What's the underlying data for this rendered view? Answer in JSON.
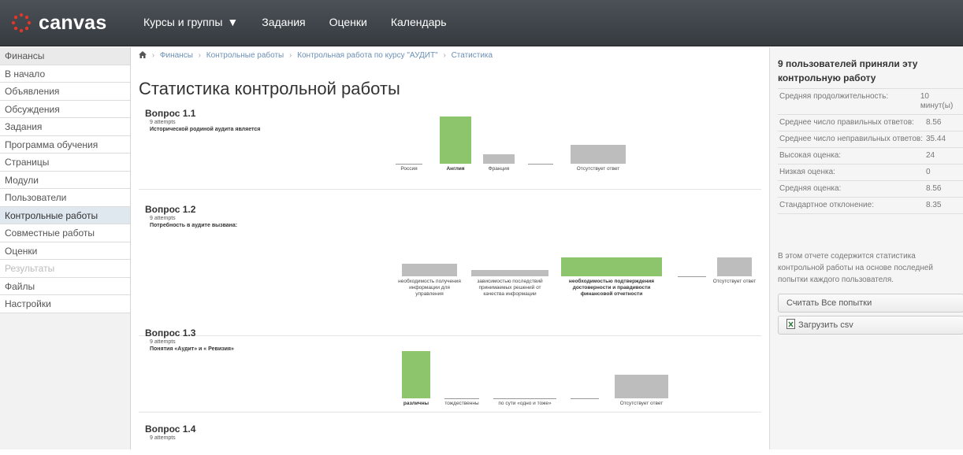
{
  "header": {
    "logo_text": "canvas",
    "nav": [
      "Курсы и группы",
      "Задания",
      "Оценки",
      "Календарь"
    ]
  },
  "sidebar": {
    "items": [
      {
        "label": "Финансы",
        "state": "course"
      },
      {
        "label": "В начало"
      },
      {
        "label": "Объявления"
      },
      {
        "label": "Обсуждения"
      },
      {
        "label": "Задания"
      },
      {
        "label": "Программа обучения"
      },
      {
        "label": "Страницы"
      },
      {
        "label": "Модули"
      },
      {
        "label": "Пользователи"
      },
      {
        "label": "Контрольные работы",
        "state": "active"
      },
      {
        "label": "Совместные работы"
      },
      {
        "label": "Оценки"
      },
      {
        "label": "Результаты",
        "state": "disabled"
      },
      {
        "label": "Файлы"
      },
      {
        "label": "Настройки"
      }
    ]
  },
  "breadcrumb": [
    "Финансы",
    "Контрольные работы",
    "Контрольная работа по курсу \"АУДИТ\"",
    "Статистика"
  ],
  "page_title": "Статистика контрольной работы",
  "questions": [
    {
      "title": "Вопрос 1.1",
      "attempts": "9 attempts",
      "text": "Исторической родиной аудита является",
      "answers": [
        {
          "label": "Россия",
          "value": 0,
          "correct": false
        },
        {
          "label": "Англия",
          "value": 5,
          "correct": true
        },
        {
          "label": "Франция",
          "value": 1,
          "correct": false
        },
        {
          "label": "",
          "value": 0,
          "correct": false
        },
        {
          "label": "Отсутствует ответ",
          "value": 2,
          "correct": false
        }
      ]
    },
    {
      "title": "Вопрос 1.2",
      "attempts": "9 attempts",
      "text": "Потребность в аудите вызвана:",
      "answers": [
        {
          "label": "необходимость получения информации для управления",
          "value": 2,
          "correct": false
        },
        {
          "label": "зависимостью последствий принимаемых решений от качества информации",
          "value": 1,
          "correct": false
        },
        {
          "label": "необходимостью подтверждения достоверности и правдивости финансовой отчетности",
          "value": 3,
          "correct": true
        },
        {
          "label": "",
          "value": 0,
          "correct": false
        },
        {
          "label": "Отсутствует ответ",
          "value": 3,
          "correct": false
        }
      ]
    },
    {
      "title": "Вопрос 1.3",
      "attempts": "9 attempts",
      "text": "Понятия «Аудит» и « Ревизия»",
      "answers": [
        {
          "label": "различны",
          "value": 6,
          "correct": true
        },
        {
          "label": "тождественны",
          "value": 0,
          "correct": false
        },
        {
          "label": "по сути «одно и тоже»",
          "value": 0,
          "correct": false
        },
        {
          "label": "",
          "value": 0,
          "correct": false
        },
        {
          "label": "Отсутствует ответ",
          "value": 3,
          "correct": false
        }
      ]
    },
    {
      "title": "Вопрос 1.4",
      "attempts": "9 attempts",
      "text": "",
      "answers": []
    }
  ],
  "summary": {
    "title": "9 пользователей приняли эту контрольную работу",
    "stats": [
      {
        "label": "Средняя продолжительность:",
        "value": "10 минут(ы)"
      },
      {
        "label": "Среднее число правильных ответов:",
        "value": "8.56"
      },
      {
        "label": "Среднее число неправильных ответов:",
        "value": "35.44"
      },
      {
        "label": "Высокая оценка:",
        "value": "24"
      },
      {
        "label": "Низкая оценка:",
        "value": "0"
      },
      {
        "label": "Средняя оценка:",
        "value": "8.56"
      },
      {
        "label": "Стандартное отклонение:",
        "value": "8.35"
      }
    ],
    "note": "В этом отчете содержится статистика контрольной работы на основе последней попытки каждого пользователя.",
    "count_button": "Считать Все попытки",
    "download_button": "Загрузить csv"
  },
  "colors": {
    "topbar": "#3f454a",
    "logo_red": "#e0372b",
    "correct_bar": "#8cc56b",
    "answer_bar": "#bdbdbd",
    "active_nav": "#dfe7ef"
  }
}
